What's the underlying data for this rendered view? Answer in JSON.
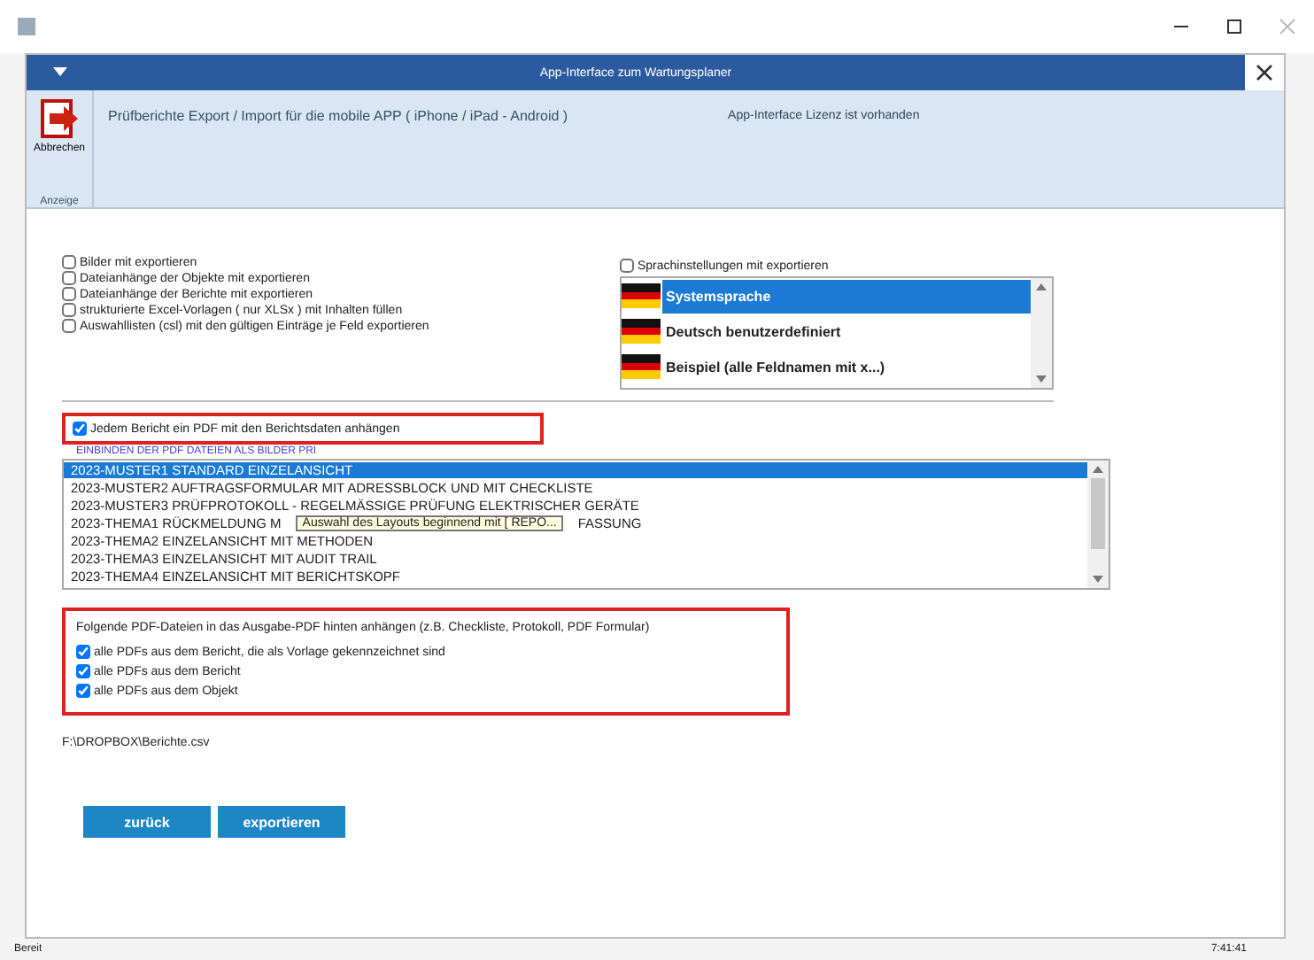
{
  "window": {
    "title": "App-Interface zum Wartungsplaner"
  },
  "ribbon": {
    "button": "Abbrechen",
    "group": "Anzeige",
    "heading": "Prüfberichte Export / Import für die mobile APP ( iPhone / iPad - Android )",
    "license": "App-Interface Lizenz ist vorhanden"
  },
  "options": [
    {
      "label": "Bilder mit exportieren",
      "checked": false
    },
    {
      "label": "Dateianhänge der Objekte mit exportieren",
      "checked": false
    },
    {
      "label": "Dateianhänge der Berichte mit exportieren",
      "checked": false
    },
    {
      "label": "strukturierte Excel-Vorlagen ( nur XLSx ) mit Inhalten füllen",
      "checked": false
    },
    {
      "label": "Auswahllisten (csl) mit den gültigen Einträge je Feld exportieren",
      "checked": false
    }
  ],
  "language": {
    "label": "Sprachinstellungen mit exportieren",
    "checked": false,
    "items": [
      {
        "label": "Systemsprache",
        "selected": true
      },
      {
        "label": "Deutsch benutzerdefiniert",
        "selected": false
      },
      {
        "label": "Beispiel (alle Feldnamen mit x...)",
        "selected": false
      }
    ]
  },
  "attach_pdf": {
    "label": "Jedem Bericht ein PDF mit den Berichtsdaten anhängen",
    "checked": true
  },
  "hint_link": "EINBINDEN DER PDF DATEIEN ALS BILDER PRI",
  "layouts": [
    {
      "text": "2023-MUSTER1 STANDARD EINZELANSICHT",
      "selected": true
    },
    {
      "text": "2023-MUSTER2 AUFTRAGSFORMULAR MIT ADRESSBLOCK UND MIT CHECKLISTE",
      "selected": false
    },
    {
      "text": "2023-MUSTER3 PRÜFPROTOKOLL - REGELMÄSSIGE PRÜFUNG ELEKTRISCHER GERÄTE",
      "selected": false
    },
    {
      "text": "2023-THEMA1 RÜCKMELDUNG M",
      "text_after": "FASSUNG",
      "selected": false
    },
    {
      "text": "2023-THEMA2 EINZELANSICHT MIT METHODEN",
      "selected": false
    },
    {
      "text": "2023-THEMA3 EINZELANSICHT MIT AUDIT TRAIL",
      "selected": false
    },
    {
      "text": "2023-THEMA4 EINZELANSICHT MIT BERICHTSKOPF",
      "selected": false
    }
  ],
  "tooltip": "Auswahl des Layouts beginnend mit [ REPO...",
  "pdf_group": {
    "title": "Folgende PDF-Dateien in das Ausgabe-PDF hinten anhängen (z.B. Checkliste, Protokoll, PDF Formular)",
    "items": [
      {
        "label": "alle PDFs aus dem Bericht, die als Vorlage gekennzeichnet sind",
        "checked": true
      },
      {
        "label": "alle PDFs aus dem Bericht",
        "checked": true
      },
      {
        "label": "alle PDFs aus dem Objekt",
        "checked": true
      }
    ]
  },
  "path": "F:\\DROPBOX\\Berichte.csv",
  "buttons": [
    "zurück",
    "exportieren"
  ],
  "status_bar": {
    "left": "Bereit",
    "time": "7:41:41"
  }
}
